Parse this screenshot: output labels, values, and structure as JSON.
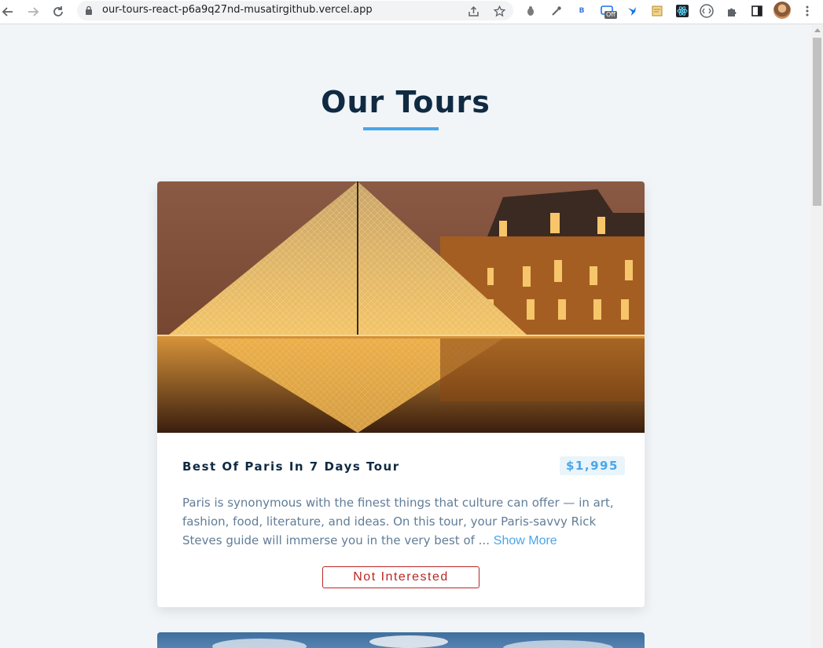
{
  "browser": {
    "url": "our-tours-react-p6a9q27nd-musatirgithub.vercel.app",
    "icons": {
      "back": "arrow-left-icon",
      "forward": "arrow-right-icon",
      "reload": "reload-icon",
      "lock": "lock-icon",
      "share": "share-icon",
      "bookmark": "star-icon",
      "menu": "kebab-menu-icon"
    },
    "extensions": {
      "letter_badge": "B",
      "off_badge": "Off"
    }
  },
  "page": {
    "title": "Our Tours",
    "accent_color": "#49a6e9",
    "danger_color": "#bb2525"
  },
  "tours": [
    {
      "name": "Best Of Paris In 7 Days Tour",
      "price": "$1,995",
      "info": "Paris is synonymous with the finest things that culture can offer — in art, fashion, food, literature, and ideas. On this tour, your Paris-savvy Rick Steves guide will immerse you in the very best of ... ",
      "show_more_label": "Show More",
      "not_interested_label": "Not Interested",
      "image": "louvre-pyramid-night-photo"
    }
  ]
}
